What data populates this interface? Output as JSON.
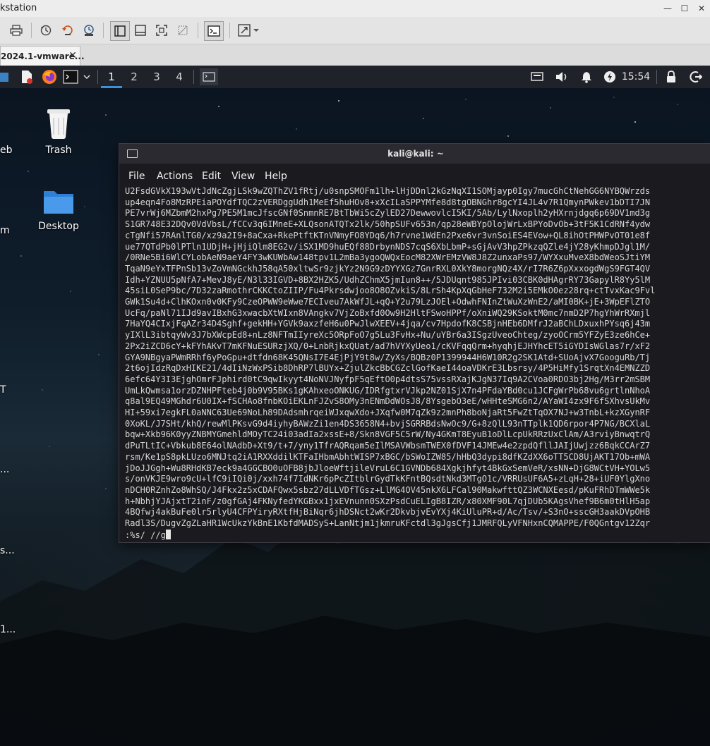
{
  "vmware": {
    "window_title": "kstation",
    "window_buttons": [
      "—",
      "☐",
      "✕"
    ],
    "tab_label": "2024.1-vmware...",
    "tab_close": "✕"
  },
  "panel": {
    "workspaces": [
      "1",
      "2",
      "3",
      "4"
    ],
    "clock": "15:54"
  },
  "desktop": {
    "trash_label": "Trash",
    "desktop_folder_label": "Desktop",
    "edge_labels": [
      "eb",
      "m",
      "T",
      "...",
      "s...",
      "1..."
    ]
  },
  "terminal": {
    "title": "kali@kali: ~",
    "menu": [
      "File",
      "Actions",
      "Edit",
      "View",
      "Help"
    ],
    "lines": [
      "U2FsdGVkX193wVtJdNcZgjLSk9wZQThZV1fRtj/u0snpSMOFm1lh+lHjDDnl2kGzNqXI1SOMjayp0Igy7mucGhCtNehGG6NYBQWrzds",
      "up4eqn4Fo8MzRPEiaPOYdfTQC2zVERDggUdh1MeEf5huHOv8+xXcILaSPPYMfe8d8tgOBNGhr8gcYI4JL4v7R1QmynPWkev1bDTI7JN",
      "PE7vrWj6MZbmM2hxPg7PE5M1mcJfscGNf0SnmnRE7BtTbWi5cZylED27DewwovlcI5KI/5Ab/LylNxoplh2yHXrnjdgq6p69DV1md3g",
      "S1GR748E32DQv0VdVbsL/fCCv3q6IMneE+XLQsonATQTx2lk/50hpSUFv653n/qp28eWBYpOlojWrLxBPYoDvOb+3tF5K1CdRNf4ydw",
      "cTgNfi57RAnlTG0/xz9a2I9+8aCxa+RkePtftKTnVNmyFO8YDq6/h7rvne1WdEn2Pxe6vr3vnSoiES4EVow+QL8ihOtPHWPvOT01e8f",
      "ue77QTdPb0lPTln1UDjH+jHjiQlm8EG2v/iSX1MD9huEQf88DrbynNDS7cqS6XbLbmP+sGjAvV3hpZPkzqQZle4jY28yKhmpDJgl1M/",
      "/0RNe5Bi6WlCYLobAeN9aeY4FY3wKUWbAw148tpv1L2mBa3ygoQWQxEocM82XWrEMzVW8J8Z2unxaPs97/WYXxuMveX8bdWeoSJtiYM",
      "TqaN9eYxTFPnSb13vZoVmNGckhJ58qA50xltwSr9zjkYz2N9G9zDYYXGz7GnrRXL0XkY8morgNQz4X/rI7R6Z6pXxxogdWgS9FGT4QV",
      "Idh+YZNUU5pNfA7+MevJ8yE/N3l33IGVD+8BX2HZK5/UdhZChmX5jmIun8++/5JDUqnt985JPIvi03CBK0dHAgrRY73GapylR8Yy5lM",
      "45siL0SeP9bc/7D32zaRmothrCKKCtoZIIP/Fu4Pkrsdwjoo8O8OZvkiS/8LrSh4KpXqGbHeF732M2i5EMkO0ez28rq+ctTvxKac9Fvl",
      "GWk1Su4d+ClhKOxn0v0KFy9CzeOPWW9eWwe7ECIveu7AkWfJL+qQ+Y2u79LzJOEl+OdwhFNInZtWuXzWnE2/aMI0BK+jE+3WpEFlZTO",
      "UcFq/paNl71IJd9avIBxhG3xwacbXtWIxn8VAngkv7VjZoBxfd0Ow9H2HltFSwoHPPf/oXniWQ29KSoktM0mc7nmD2P7hgYhWrRXmjl",
      "7HaYQ4CIxjFqAZr34D4Sghf+gekHH+YGVk9axzfeH6u0PwJlwXEEV+4jqa/cv7HpdofK8CSBjnHEb6DMfrJ2aBChLDxuxhPYsq6j43m",
      "yIXlL3ibtqyWv3J7bXWcpEd8+nLz8NFTmIIyreXc5ORpFoO7g5Lu3FvHx+Nu/uYBr6a3ISgzUveoChteg/zyoOCrm5YFZyE3ze6hCe+",
      "2Px2iZCD6cY+kFYhAKvT7mKFNuESURzjXQ/0+LnbRjkxQUat/ad7hVYXyUeo1/cKVFqqQrm+hyqhjEJHYhcET5iGYDIsWGlas7r/xF2",
      "GYA9NBgyaPWmRRhf6yPoGpu+dtfdn68K45QNsI7E4EjPjY9t8w/ZyXs/BQBz0P1399944H6W10R2g2SK1Atd+SUoAjvX7GooguRb/Tj",
      "2t6ojIdzRqDxHIKE21/4dIiNzWxPSib8DhRP7lBUYx+ZjulZkcBbCGZclGofKaeI44oaVDKrE3Lbsrsy/4P5HiMfy1SrqtXn4EMNZZD",
      "6efc64Y3I3EjghOmrFJphird0tC9qwIkyyt4NoNVJNyfpF5qEftO0p4dtsS75vssRXajKJgN37Iq9A2CVoa0RDO3bj2Hg/M3rr2mSBM",
      "UmLkQwmsa1orzDZNHPFteb4j0b9V95BKs1gKAhxeoONKUG/IDRfgtxrVJkp2NZ01SjX7n4PFdaYBd0cu1JCFgWrPb68vu6grtlnNhoA",
      "q8al9EQ49MGhdr6U0IX+fSCHAo8fnbKOiEKLnFJZvS8OMy3nENmDdWOsJ8/8YsgebO3eE/wHHteSMG6n2/AYaWI4zx9F6fSXhvsUkMv",
      "HI+59xi7egkFL0aNNC63Ue69NoLh89DAdsmhrqeiWJxqwXdo+JXqfw0M7qZk9z2mnPh8boNjaRt5FwZtTqOX7NJ+w3TnbL+kzXGynRF",
      "0XoKL/J7SHt/khQ/rewMlPKsvG9d4iyhyBAWzZi1en4DS3658N4+bvjSGRRBdsNwOc9/G+8zQlL93nTTplk1QD6rpor4P7NG/BCXlaL",
      "bqw+Xkb96K0yyZNBMYGmehldMOyTC24i03adIa2xssE+8/Skn8VGF5C5rW/Ny4GKmT8EyuB1oDlLcpUkRRzUxClAm/A3rviyBnwqtrQ",
      "dPuTLtIC+Vbkub8E64olNAdbD+Xt9/t+7/yny1TfrAQRqam5eIlMSAVWbsmTWEX0fDVF14JMEw4e2zpdQfllJAIjUwjzz6BqkCCArZ7",
      "rsm/Ke1pS8pkLUzo6MNJtq2iA1RXXddilKTFaIHbmAbhtWISP7xBGC/bSWoIZW85/hHbQ3dypi8dfKZdXX6oTT5CD8UjAKT17Ob+mWA",
      "jDoJJGgh+Wu8RHdKB7eck9a4GGCBO0uOFB8jbJloeWftjileVruL6C1GVNDb684Xgkjhfyt4BkGxSemVeR/xsNN+DjG8WCtVH+YOLw5",
      "s/onVKJE9wro9cU+lfC9iIQi0j/xxh74f7IdNKr6pPcZItblrGydTkKFntBQsdtNkd3MTgO1c/VRRUsUF6A5+zLqH+28+iUF0YlgXno",
      "nDCH0RZnhZo8WhSQ/J4Fkx2z5xCDAFQwx5sbz27dLLVDfTGsz+LlMG4OV45nkX6LFCal90MakwfttQZ3WCNXEesd/pKuFRhDTmWWe5k",
      "h+NbhjYJAjxtT2inF/z0gfGAj4FKNyfedYKGBxx1jxEVnunn0SXzPsdCuELIgB8IZR/x80XMF90L7qjDUb5KAgsVhef9B6m0tHlH5ap",
      "4BQfwj4akBuFe0lr5rlyU4CFPYiryRXtfHjBiNqr6jhDSNct2wKr2DkvbjvEvYXj4KiUluPR+d/Ac/Tsv/+S3nO+sscGH3aakDVpOHB",
      "Radl3S/DugvZgZLaHR1WcUkzYkBnE1KbfdMADSyS+LanNtjm1jkmruKFctdl3gJgsCfj1JMRFQLyVFNHxnCQMAPPE/F0QGntgv12Zqr"
    ],
    "command": ":%s/ //g"
  }
}
